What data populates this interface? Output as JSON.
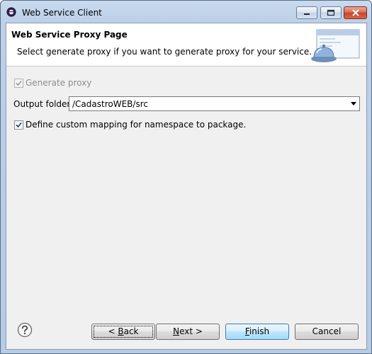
{
  "window": {
    "title": "Web Service Client",
    "icon": "eclipse-app-icon"
  },
  "banner": {
    "title": "Web Service Proxy Page",
    "description": "Select generate proxy if you want to generate proxy for your service.",
    "graphic": "service-bell-window-graphic"
  },
  "form": {
    "generate_proxy": {
      "label": "Generate proxy",
      "checked": true,
      "enabled": false
    },
    "output_folder": {
      "label": "Output folder",
      "value": "/CadastroWEB/src"
    },
    "custom_mapping": {
      "label": "Define custom mapping for namespace to package.",
      "checked": true,
      "enabled": true
    }
  },
  "buttons": {
    "help": "question-mark-icon",
    "back": {
      "prefix": "< ",
      "mnemonic": "B",
      "rest": "ack"
    },
    "next": {
      "mnemonic": "N",
      "rest": "ext >"
    },
    "finish": {
      "mnemonic": "F",
      "rest": "inish"
    },
    "cancel": "Cancel"
  }
}
